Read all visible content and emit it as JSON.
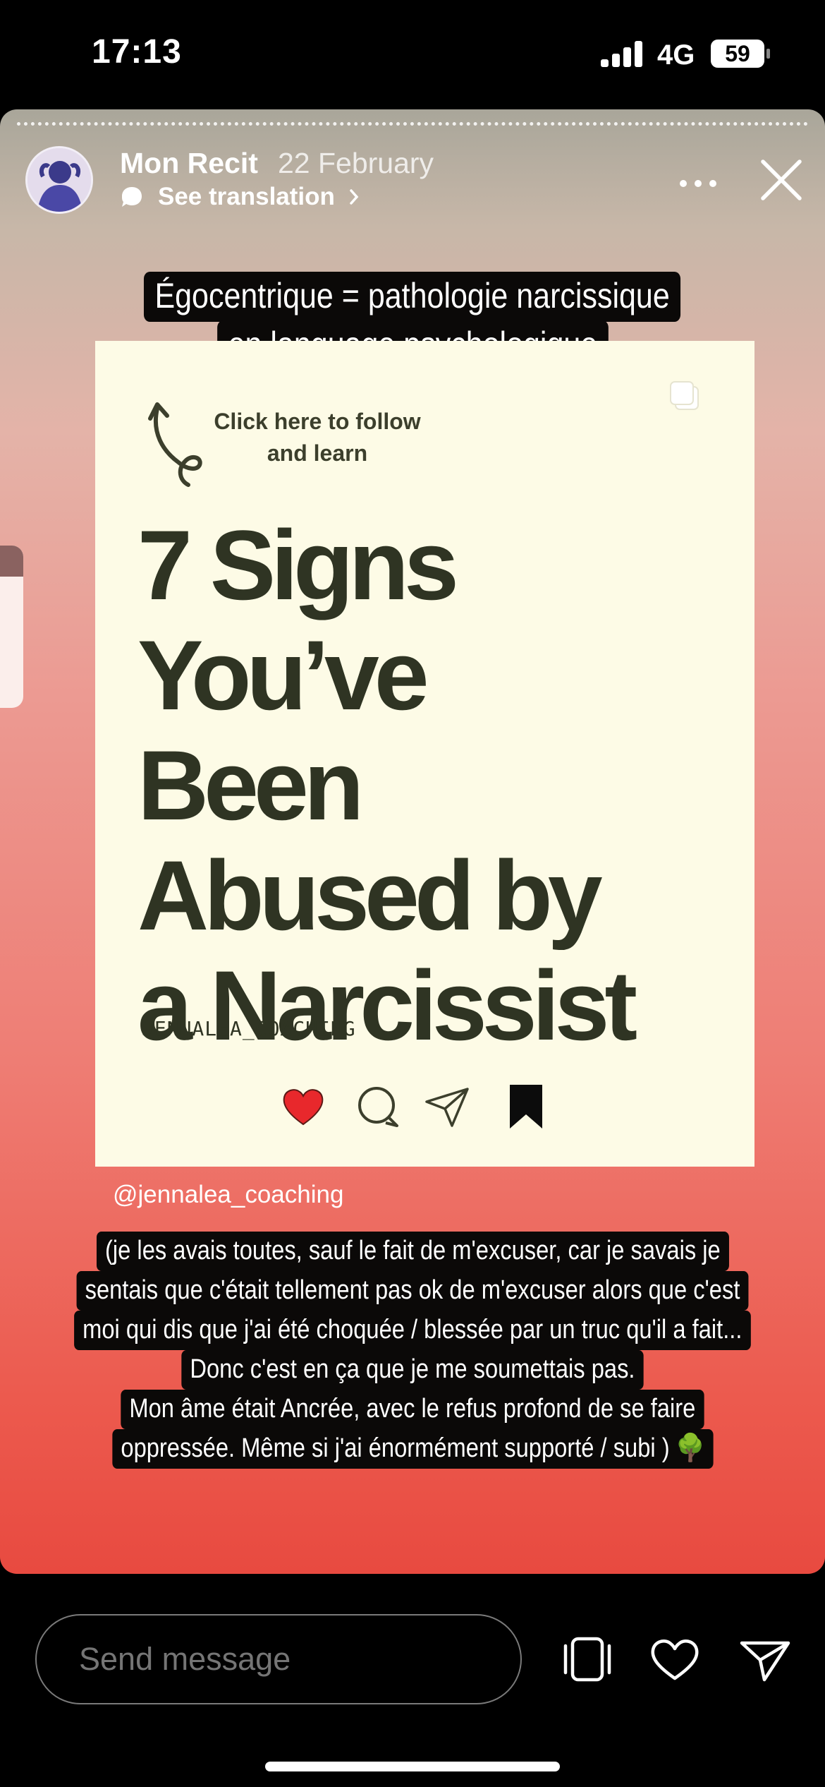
{
  "status_bar": {
    "time": "17:13",
    "network": "4G",
    "battery": "59"
  },
  "story": {
    "username": "Mon Recit",
    "date": "22 February",
    "translation_label": "See translation",
    "caption_top": [
      "Égocentrique = pathologie narcissique",
      "en language psychologique"
    ],
    "post": {
      "click_text": [
        "Click here to follow",
        "and learn"
      ],
      "headline": [
        "7 Signs",
        "You’ve",
        "Been",
        "Abused by",
        "a Narcissist"
      ],
      "brand": "JENNALEA_COACHING"
    },
    "mention": "@jennalea_coaching",
    "caption_bottom": [
      "(je les avais toutes, sauf le fait de m'excuser, car je savais je",
      "sentais que c'était tellement pas ok de m'excuser alors que c'est",
      "moi qui dis que j'ai été choquée / blessée par un truc qu'il a fait...",
      "Donc c'est en ça que je me soumettais pas.",
      "Mon âme était Ancrée, avec le refus profond de se faire",
      "oppressée. Même si j'ai énormément supporté / subi ) 🌳"
    ]
  },
  "bottom_bar": {
    "message_placeholder": "Send message"
  },
  "colors": {
    "headline": "#2f3423",
    "card_bg": "#fdfbe6",
    "heart": "#e8282c",
    "story_bottom": "#e84a40"
  }
}
